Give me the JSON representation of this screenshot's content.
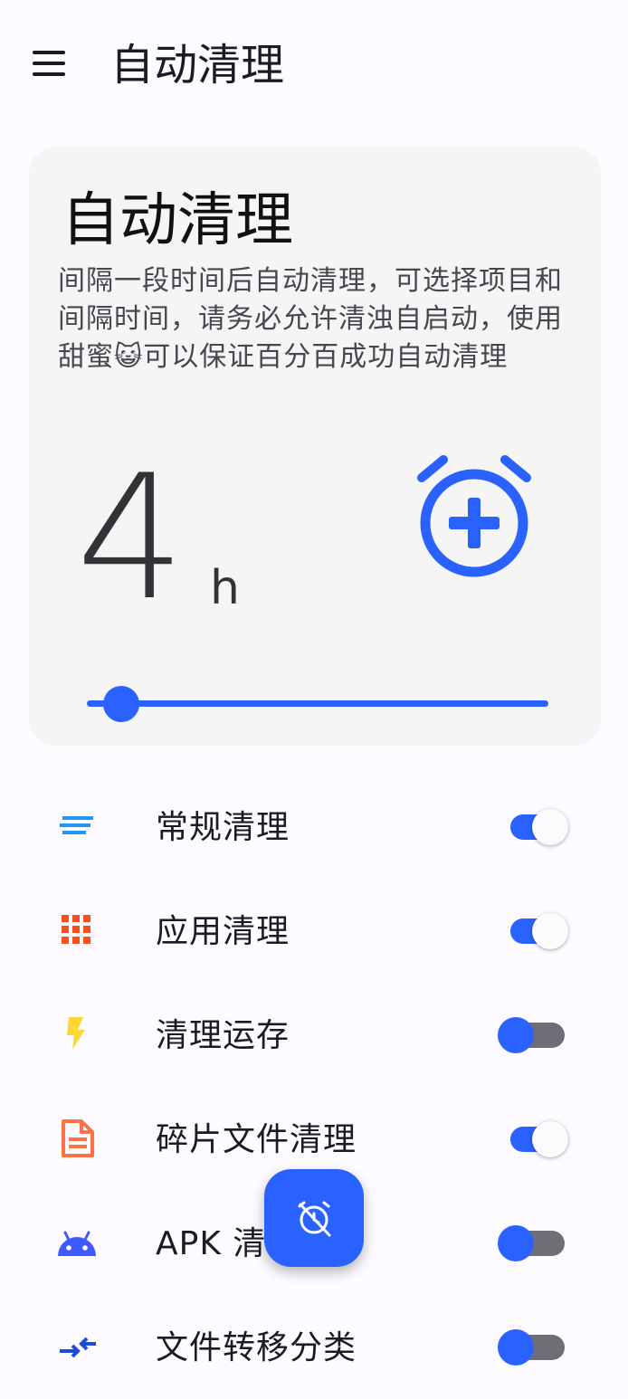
{
  "app_bar": {
    "title": "自动清理"
  },
  "card": {
    "title": "自动清理",
    "description": "间隔一段时间后自动清理，可选择项目和间隔时间，请务必允许清浊自启动，使用甜蜜😺可以保证百分百成功自动清理",
    "interval_value": "4",
    "interval_unit": "h",
    "slider_level_fraction": 0.04
  },
  "items": [
    {
      "label": "常规清理",
      "icon": "lines-icon",
      "enabled": true
    },
    {
      "label": "应用清理",
      "icon": "grid-icon",
      "enabled": true
    },
    {
      "label": "清理运存",
      "icon": "bolt-icon",
      "enabled": false
    },
    {
      "label": "碎片文件清理",
      "icon": "document-icon",
      "enabled": true
    },
    {
      "label": "APK 清",
      "icon": "android-icon",
      "enabled": false
    },
    {
      "label": "文件转移分类",
      "icon": "transfer-icon",
      "enabled": false
    }
  ],
  "fab": {
    "icon": "alarm-off-icon"
  },
  "colors": {
    "accent": "#2962ff",
    "lines_icon": "#2196f3",
    "grid_icon": "#f4511e",
    "bolt_icon": "#fdd835",
    "document_icon": "#ff7043",
    "android_icon": "#3d5afe",
    "transfer_icon": "#1e4bd8"
  }
}
